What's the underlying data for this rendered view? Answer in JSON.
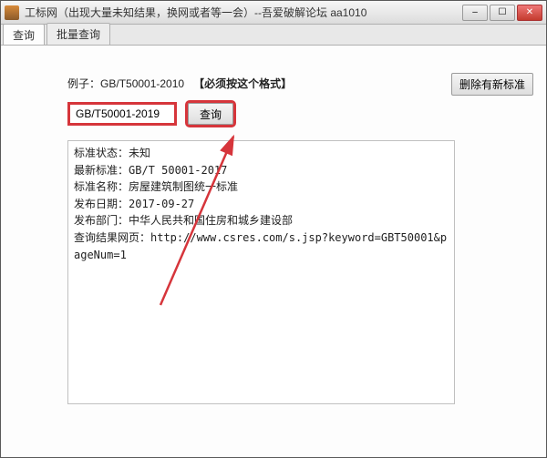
{
  "window": {
    "title": "工标网（出现大量未知结果，换网或者等一会）--吾爱破解论坛 aa1010"
  },
  "tabs": {
    "query": "查询",
    "batch": "批量查询"
  },
  "buttons": {
    "delete_new": "删除有新标准",
    "query": "查询"
  },
  "example": {
    "label": "例子：",
    "value": "GB/T50001-2010",
    "hint": "【必须按这个格式】"
  },
  "input": {
    "value": "GB/T50001-2019"
  },
  "result": {
    "line1": "标准状态：未知",
    "line2": "最新标准：GB/T 50001-2017",
    "line3": "标准名称：房屋建筑制图统一标准",
    "line4": "发布日期：2017-09-27",
    "line5": "发布部门：中华人民共和国住房和城乡建设部",
    "line6": "查询结果网页：http://www.csres.com/s.jsp?keyword=GBT50001&pageNum=1"
  }
}
